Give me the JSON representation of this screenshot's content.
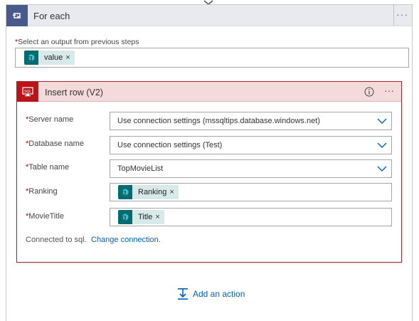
{
  "foreach": {
    "title": "For each",
    "more_label": "···",
    "select_label": "Select an output from previous steps",
    "required_mark": "*",
    "token": {
      "label": "value",
      "remove": "×"
    }
  },
  "insert_row": {
    "title": "Insert row (V2)",
    "more_label": "···",
    "fields": [
      {
        "label": "Server name",
        "value": "Use connection settings (mssqltips.database.windows.net)"
      },
      {
        "label": "Database name",
        "value": "Use connection settings (Test)"
      },
      {
        "label": "Table name",
        "value": "TopMovieList"
      },
      {
        "label": "Ranking",
        "token": "Ranking",
        "remove": "×"
      },
      {
        "label": "MovieTitle",
        "token": "Title",
        "remove": "×"
      }
    ],
    "connected_text": "Connected to sql.",
    "change_connection": "Change connection."
  },
  "add_action": "Add an action",
  "colors": {
    "foreach_accent": "#485a8c",
    "insert_accent": "#ba141a",
    "insert_header_bg": "#f4dadb",
    "token_icon": "#036c70",
    "token_bg": "#d8e9ea",
    "link": "#0062b1"
  }
}
